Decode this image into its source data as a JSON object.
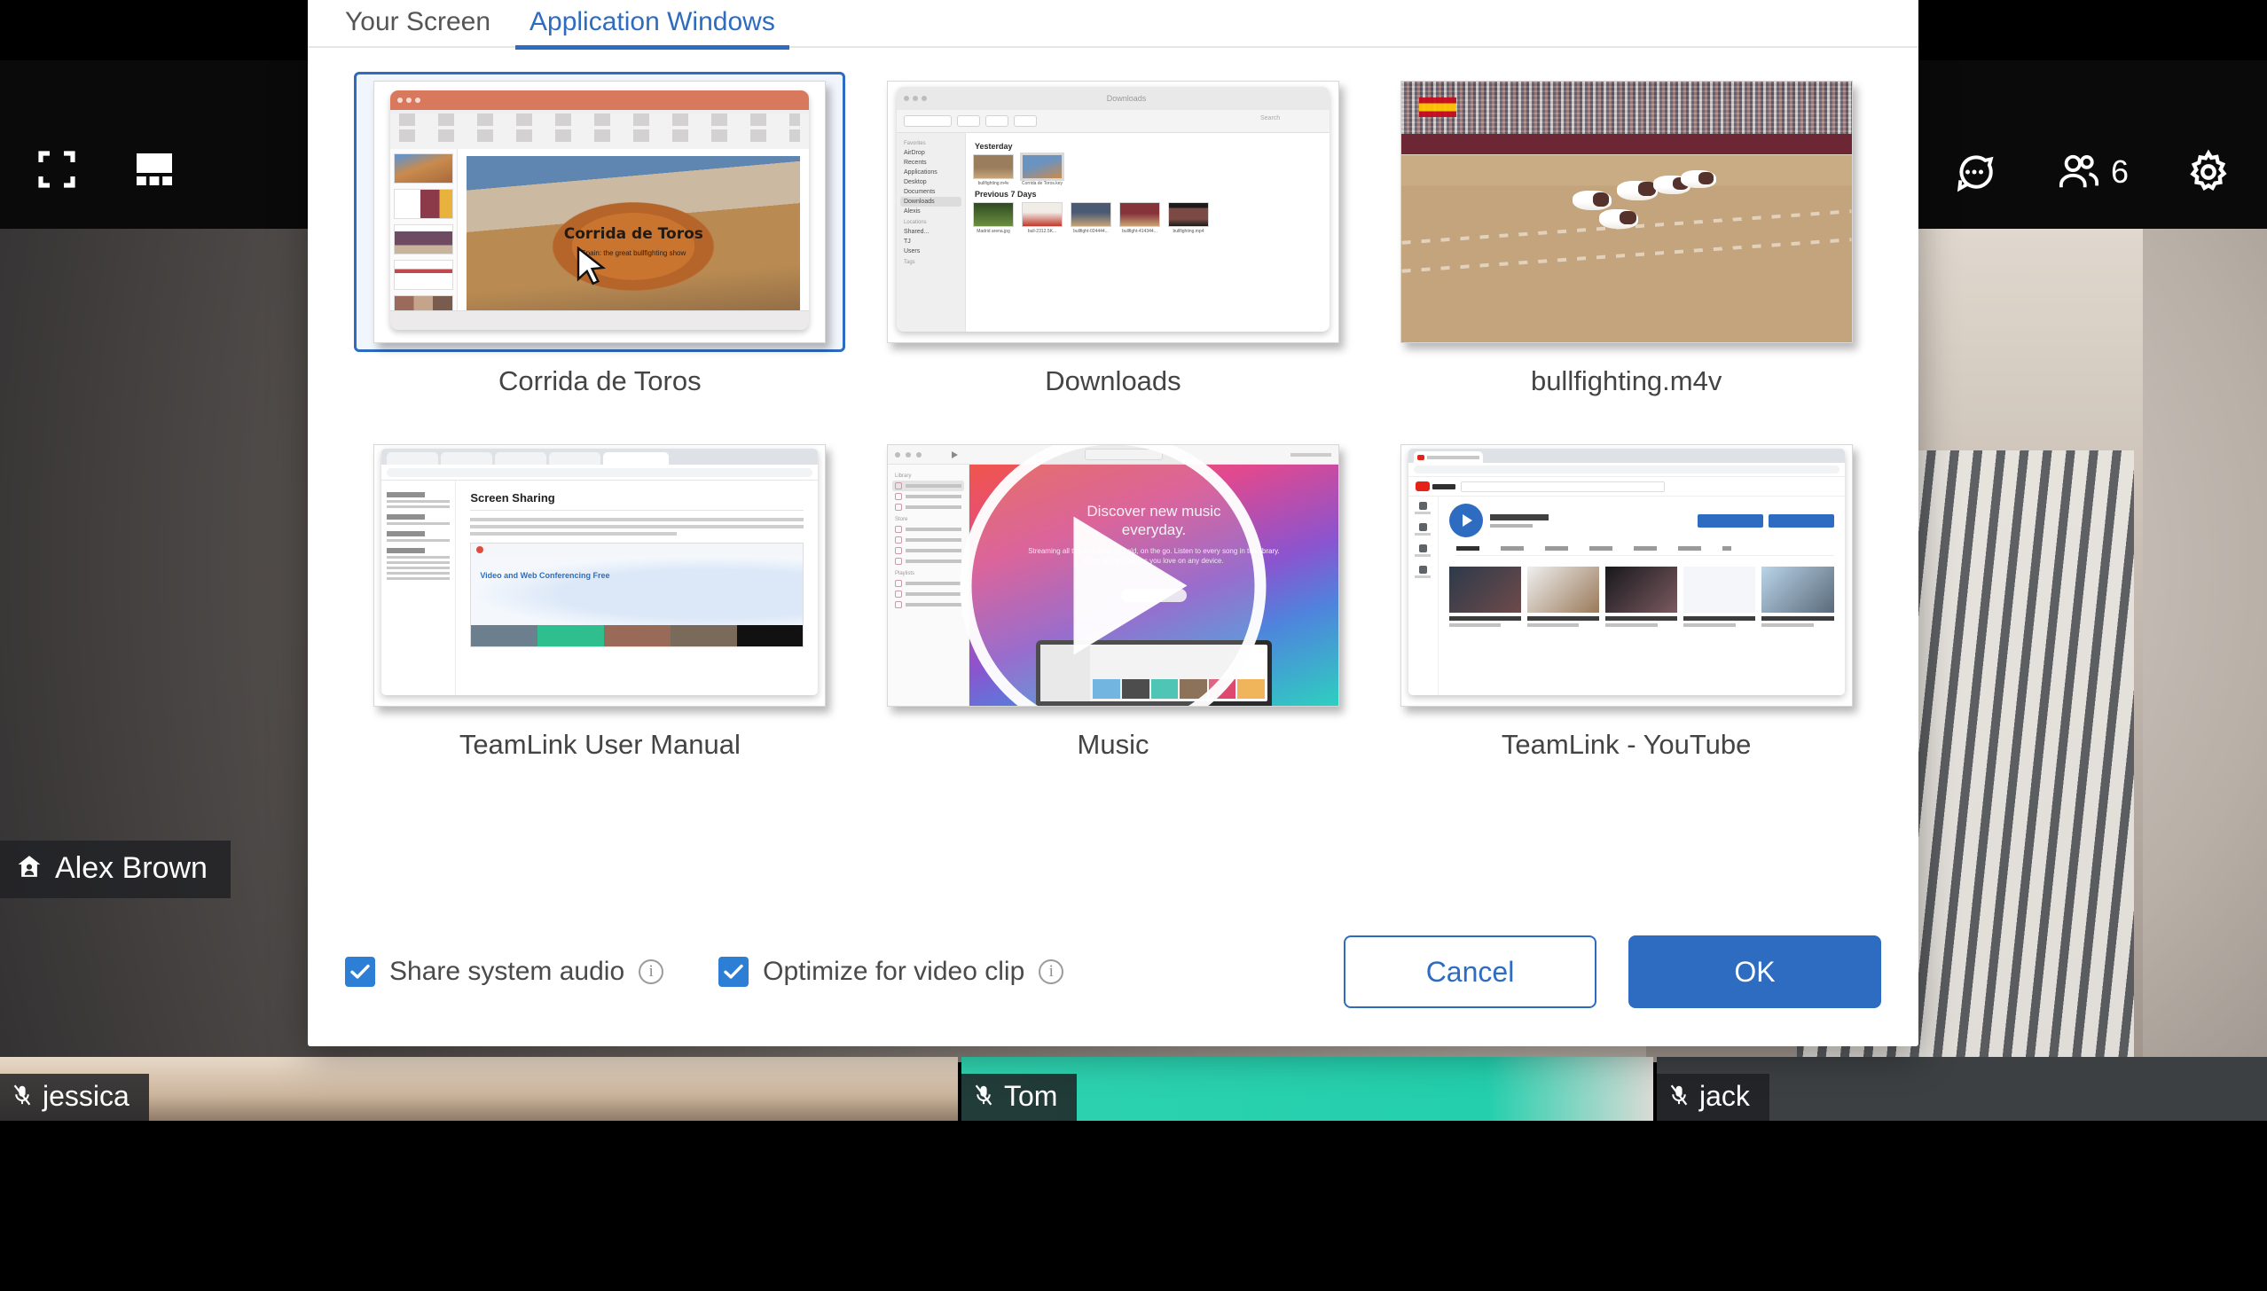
{
  "meeting": {
    "topbar": {
      "fullscreen_icon": "fullscreen-icon",
      "gallery_icon": "gallery-view-icon",
      "chat_icon": "chat-icon",
      "participants_icon": "participants-icon",
      "participants_count": "6",
      "settings_icon": "gear-icon"
    },
    "stage": {
      "host_name": "Alex Brown",
      "host_icon": "host-home-icon"
    },
    "filmstrip": [
      {
        "name": "jessica",
        "mic": "mic-muted-icon"
      },
      {
        "name": "Tom",
        "mic": "mic-muted-icon"
      },
      {
        "name": "jack",
        "mic": "mic-muted-icon"
      }
    ]
  },
  "dialog": {
    "tabs": [
      {
        "label": "Your Screen",
        "active": false
      },
      {
        "label": "Application Windows",
        "active": true
      }
    ],
    "windows": [
      {
        "label": "Corrida de Toros",
        "selected": true,
        "preview": {
          "app": "keynote",
          "slide_title": "Corrida de Toros",
          "slide_subtitle": "Spain: the great bullfighting show"
        }
      },
      {
        "label": "Downloads",
        "selected": false,
        "preview": {
          "app": "finder",
          "title": "Downloads",
          "search_placeholder": "Search",
          "sidebar_header_favorites": "Favorites",
          "sidebar_items": [
            "AirDrop",
            "Recents",
            "Applications",
            "Desktop",
            "Documents",
            "Downloads",
            "Alexis"
          ],
          "sidebar_header_locations": "Locations",
          "sidebar_locations": [
            "Shared...",
            "TJ",
            "Users"
          ],
          "sidebar_header_tags": "Tags",
          "groups": [
            {
              "title": "Yesterday",
              "files": [
                "bullfighting.m4v",
                "Corrida de Toros.key"
              ]
            },
            {
              "title": "Previous 7 Days",
              "files": [
                "Madrid arena.jpg",
                "bull-2312.5K...",
                "bullfight-024444...",
                "bullfight-414344...",
                "bullfighting.mp4"
              ]
            }
          ]
        }
      },
      {
        "label": "bullfighting.m4v",
        "selected": false,
        "preview": {
          "app": "video",
          "scene": "bullring-with-cattle"
        }
      },
      {
        "label": "TeamLink User Manual",
        "selected": false,
        "preview": {
          "app": "browser-docs",
          "page_title": "Screen Sharing",
          "hero_heading": "Video and Web Conferencing Free"
        }
      },
      {
        "label": "Music",
        "selected": false,
        "preview": {
          "app": "music",
          "headline_line1": "Discover new music",
          "headline_line2": "everyday.",
          "body": "Streaming all the hits, new and old, on the go. Listen to every song in the library. Plus, all the classics you love on any device.",
          "play_overlay": "play-button-overlay"
        }
      },
      {
        "label": "TeamLink - YouTube",
        "selected": false,
        "preview": {
          "app": "youtube",
          "page": "TeamLink channel"
        }
      }
    ],
    "options": [
      {
        "label": "Share system audio",
        "checked": true,
        "info_icon": "info-icon"
      },
      {
        "label": "Optimize for video clip",
        "checked": true,
        "info_icon": "info-icon"
      }
    ],
    "buttons": {
      "cancel": "Cancel",
      "ok": "OK"
    }
  },
  "colors": {
    "accent": "#2d6cc0",
    "checkbox": "#2d7fd6",
    "tab_active": "#2d6cc0",
    "topbar_bg": "#0a0a0a",
    "stage_bg": "#3c4043"
  }
}
